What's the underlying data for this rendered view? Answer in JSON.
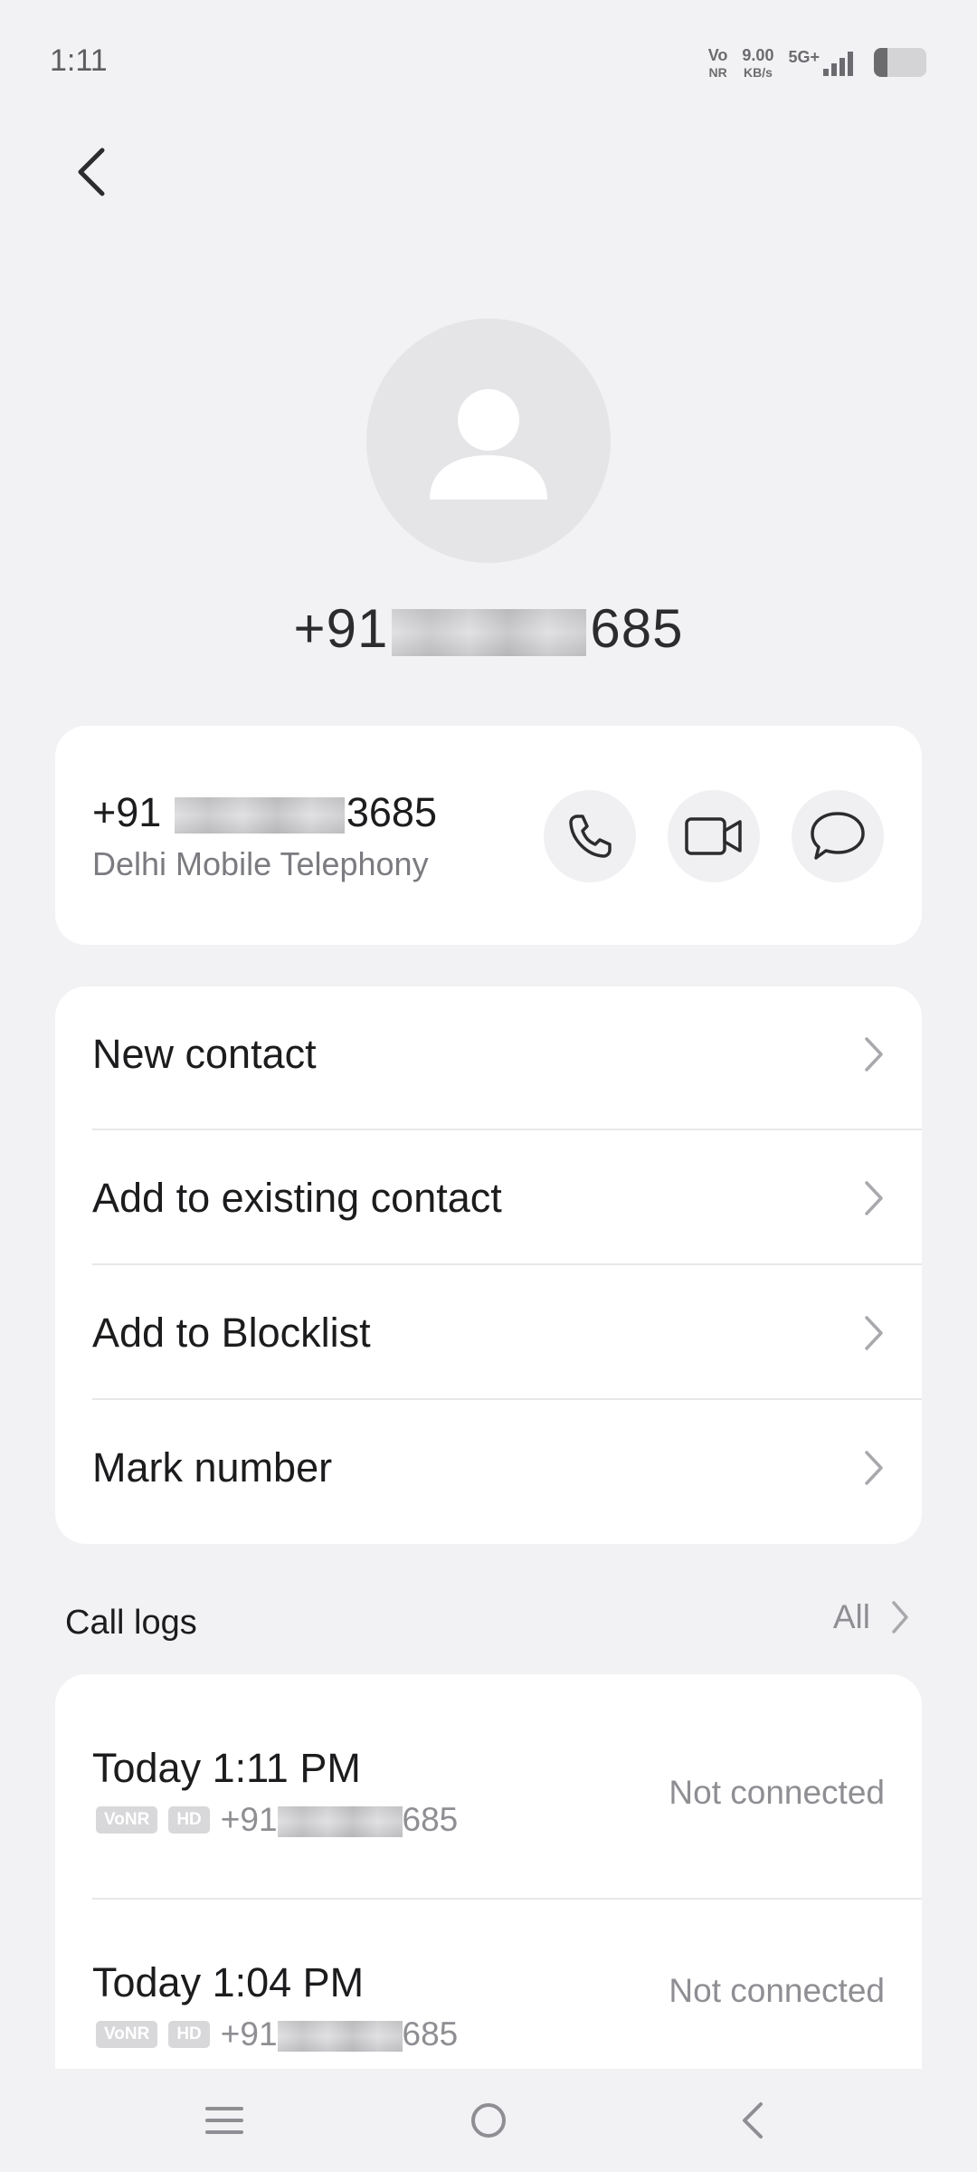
{
  "status_bar": {
    "time": "1:11",
    "vonr_top": "Vo",
    "vonr_bottom": "NR",
    "speed_value": "9.00",
    "speed_unit": "KB/s",
    "network": "5G+",
    "battery_level": 0.25
  },
  "contact": {
    "title_prefix": "+91",
    "title_suffix": "685",
    "number_prefix": "+91",
    "number_suffix": "3685",
    "carrier": "Delhi Mobile Telephony"
  },
  "actions": [
    {
      "label": "New contact"
    },
    {
      "label": "Add to existing contact"
    },
    {
      "label": "Add to Blocklist"
    },
    {
      "label": "Mark number"
    }
  ],
  "call_logs": {
    "title": "Call logs",
    "all_label": "All",
    "entries": [
      {
        "time": "Today 1:11 PM",
        "tag1": "VoNR",
        "tag2": "HD",
        "number_prefix": "+91",
        "number_suffix": "685",
        "status": "Not connected"
      },
      {
        "time": "Today 1:04 PM",
        "tag1": "VoNR",
        "tag2": "HD",
        "number_prefix": "+91",
        "number_suffix": "685",
        "status": "Not connected"
      }
    ]
  },
  "colors": {
    "background": "#f2f2f4",
    "card": "#ffffff",
    "text_primary": "#1c1c1e",
    "text_secondary": "#8e8e93"
  },
  "icons": [
    "back-icon",
    "person-icon",
    "phone-icon",
    "video-icon",
    "message-icon",
    "chevron-right-icon",
    "menu-icon",
    "home-icon",
    "back-triangle-icon"
  ]
}
